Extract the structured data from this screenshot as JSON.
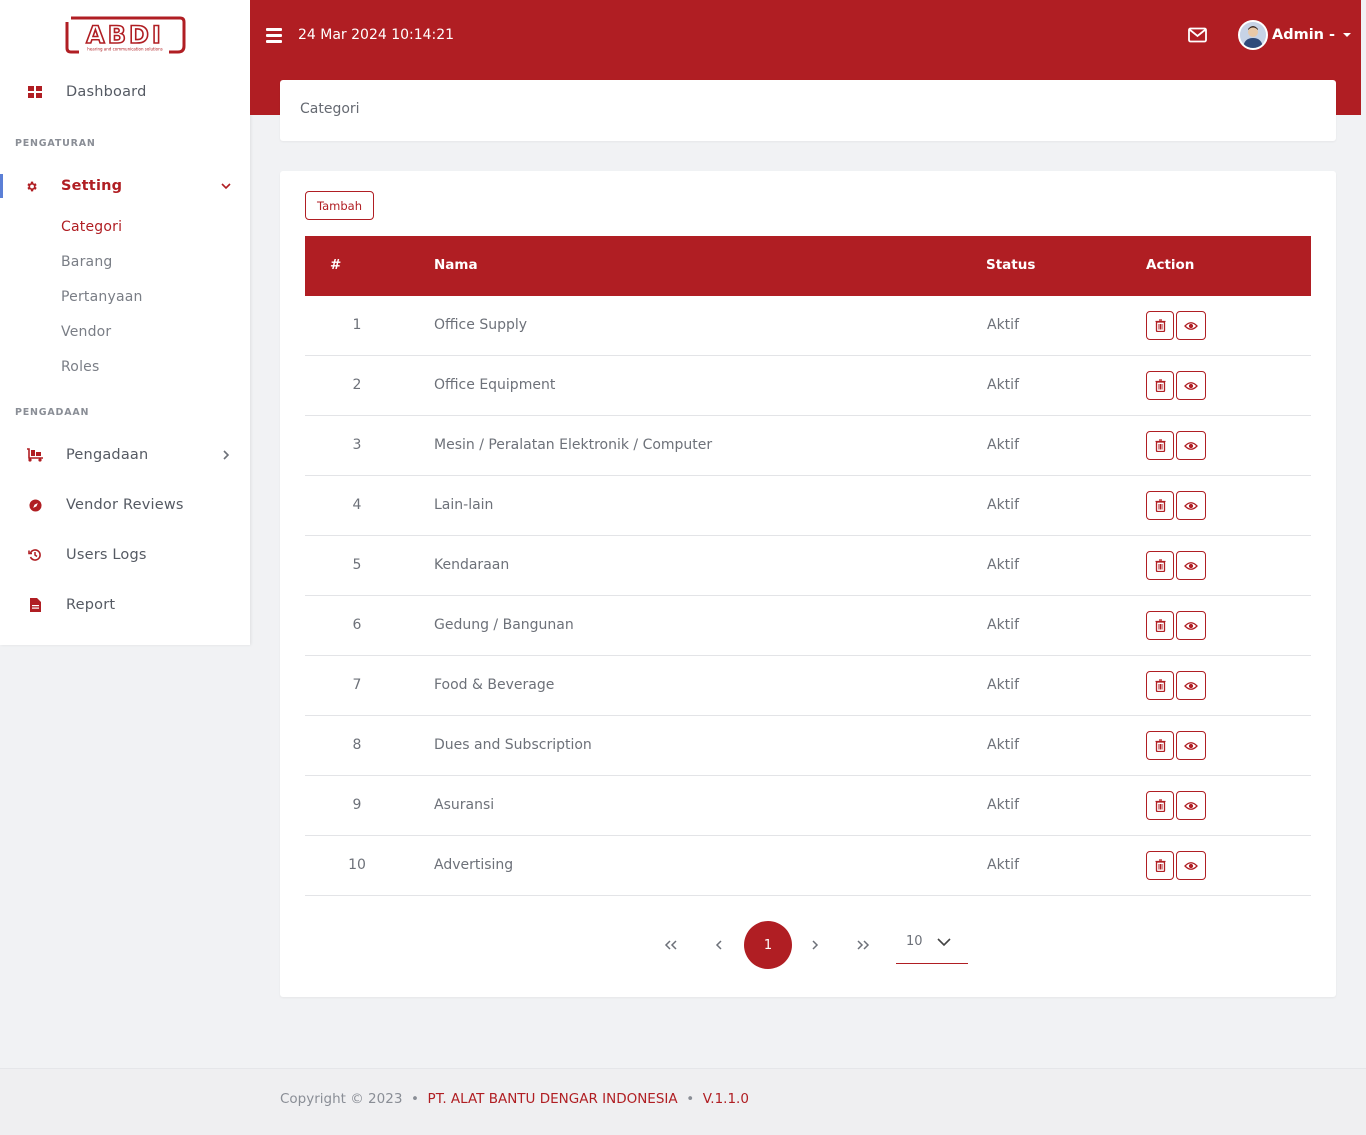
{
  "brand": {
    "logo_text": "ABDI",
    "tagline": "hearing and communication solutions"
  },
  "header": {
    "datetime": "24 Mar 2024 10:14:21",
    "user_label": "Admin -"
  },
  "sidebar": {
    "dashboard": "Dashboard",
    "section_pengaturan": "PENGATURAN",
    "setting": "Setting",
    "setting_children": [
      "Categori",
      "Barang",
      "Pertanyaan",
      "Vendor",
      "Roles"
    ],
    "section_pengadaan": "PENGADAAN",
    "pengadaan": "Pengadaan",
    "vendor_reviews": "Vendor Reviews",
    "users_logs": "Users Logs",
    "report": "Report"
  },
  "breadcrumb": {
    "title": "Categori"
  },
  "toolbar": {
    "add_label": "Tambah"
  },
  "table": {
    "headers": {
      "no": "#",
      "nama": "Nama",
      "status": "Status",
      "action": "Action"
    },
    "rows": [
      {
        "no": "1",
        "nama": "Office Supply",
        "status": "Aktif"
      },
      {
        "no": "2",
        "nama": "Office Equipment",
        "status": "Aktif"
      },
      {
        "no": "3",
        "nama": "Mesin / Peralatan Elektronik / Computer",
        "status": "Aktif"
      },
      {
        "no": "4",
        "nama": "Lain-lain",
        "status": "Aktif"
      },
      {
        "no": "5",
        "nama": "Kendaraan",
        "status": "Aktif"
      },
      {
        "no": "6",
        "nama": "Gedung / Bangunan",
        "status": "Aktif"
      },
      {
        "no": "7",
        "nama": "Food & Beverage",
        "status": "Aktif"
      },
      {
        "no": "8",
        "nama": "Dues and Subscription",
        "status": "Aktif"
      },
      {
        "no": "9",
        "nama": "Asuransi",
        "status": "Aktif"
      },
      {
        "no": "10",
        "nama": "Advertising",
        "status": "Aktif"
      }
    ]
  },
  "pagination": {
    "current_page": "1",
    "page_size": "10"
  },
  "footer": {
    "copyright": "Copyright © 2023",
    "company": "PT. ALAT BANTU DENGAR INDONESIA",
    "version": "V.1.1.0"
  },
  "colors": {
    "primary": "#b01e23",
    "background": "#f1f2f4",
    "active_indicator": "#5b7fd6"
  }
}
